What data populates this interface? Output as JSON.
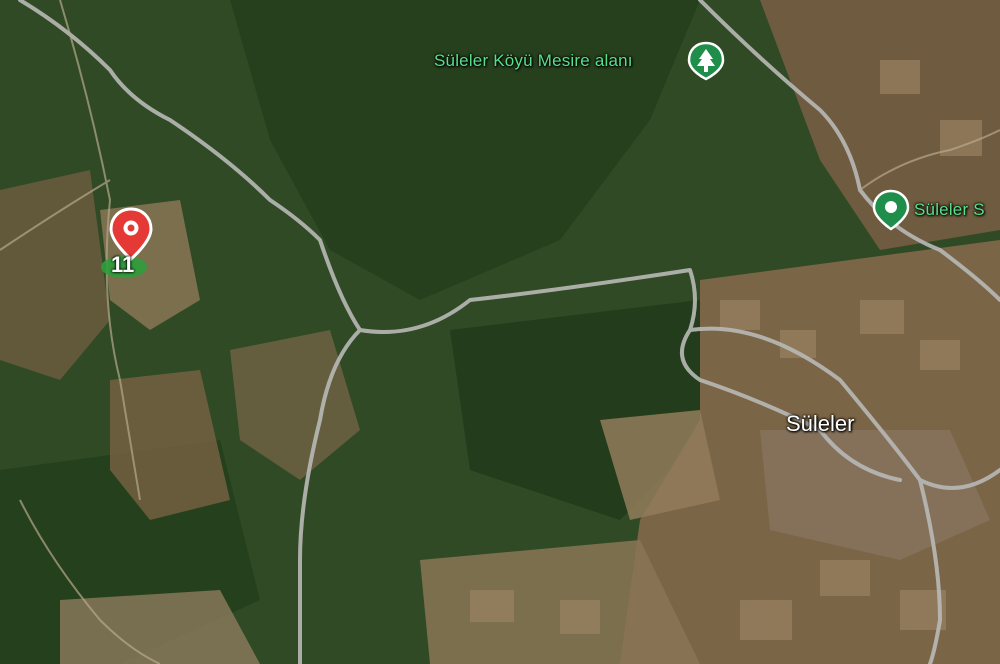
{
  "map": {
    "type": "satellite",
    "colors": {
      "forest": "#2f4a25",
      "forest_dark": "#213819",
      "field": "#8a7556",
      "road": "#b9b9b6",
      "poi_green": "#1e8e4a",
      "poi_label": "#58e08a",
      "pin_red": "#e53935"
    }
  },
  "labels": {
    "poi_park": "Süleler Köyü Mesire alanı",
    "poi_right": "Süleler S",
    "town": "Süleler"
  },
  "marker": {
    "icon": "map-pin-icon",
    "count": "11"
  },
  "icons": {
    "park": "tree-icon",
    "place": "place-pin-icon"
  }
}
